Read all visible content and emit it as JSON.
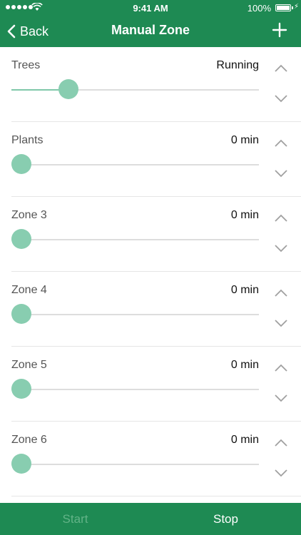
{
  "status_bar": {
    "time": "9:41 AM",
    "battery": "100%"
  },
  "nav": {
    "back_label": "Back",
    "title": "Manual Zone"
  },
  "zones": [
    {
      "name": "Trees",
      "value": "Running",
      "level": 0.23
    },
    {
      "name": "Plants",
      "value": "0 min",
      "level": 0
    },
    {
      "name": "Zone 3",
      "value": "0 min",
      "level": 0
    },
    {
      "name": "Zone 4",
      "value": "0 min",
      "level": 0
    },
    {
      "name": "Zone 5",
      "value": "0 min",
      "level": 0
    },
    {
      "name": "Zone 6",
      "value": "0 min",
      "level": 0
    }
  ],
  "footer": {
    "start_label": "Start",
    "stop_label": "Stop"
  },
  "colors": {
    "brand": "#1e8a53",
    "accent": "#88cdb0"
  },
  "icons": {
    "back": "chevron-left-icon",
    "add": "plus-icon",
    "up": "chevron-up-icon",
    "down": "chevron-down-icon"
  }
}
